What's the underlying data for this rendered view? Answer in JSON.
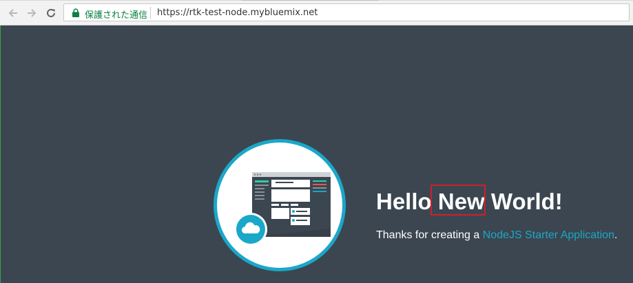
{
  "browser": {
    "secure_label": "保護された通信",
    "url": "https://rtk-test-node.mybluemix.net"
  },
  "hero": {
    "hello_word": "Hello",
    "new_word": "New",
    "world_word": "World!",
    "thanks_prefix": "Thanks for creating a ",
    "link_text": "NodeJS Starter Application",
    "thanks_suffix": "."
  },
  "colors": {
    "page_bg": "#3b4650",
    "accent": "#1ba7c9",
    "highlight_box": "#d11f2d",
    "secure_green": "#0b8043"
  },
  "icons": [
    "back-arrow-icon",
    "forward-arrow-icon",
    "reload-icon",
    "lock-icon",
    "cloud-icon"
  ]
}
